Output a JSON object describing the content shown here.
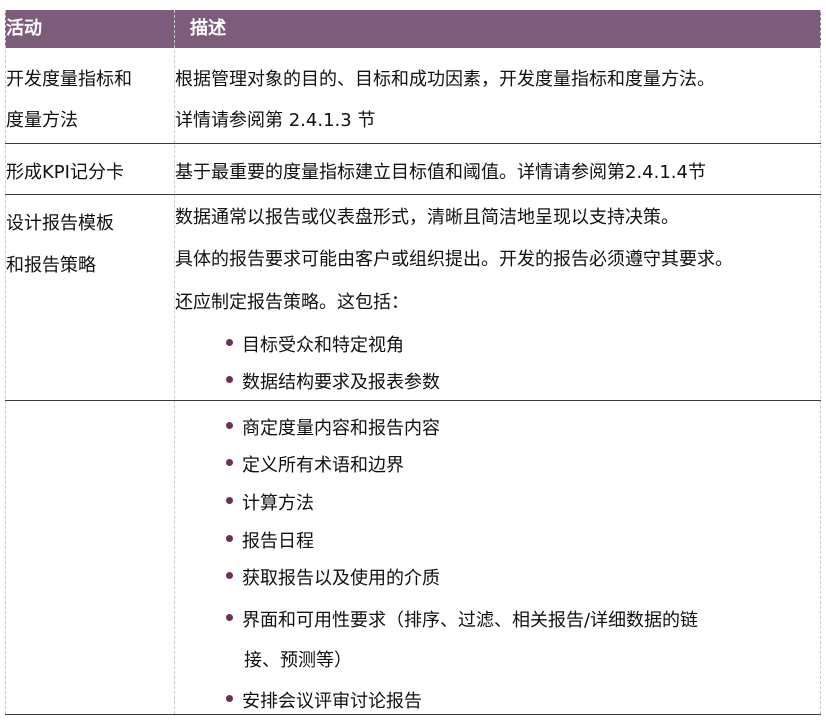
{
  "table": {
    "header": {
      "activity": "活动",
      "description": "描述"
    },
    "rows": [
      {
        "activity_lines": [
          "开发度量指标和",
          "度量方法"
        ],
        "desc_lines": [
          "根据管理对象的目的、目标和成功因素，开发度量指标和度量方法。",
          "详情请参阅第 2.4.1.3 节"
        ]
      },
      {
        "activity_lines": [
          "形成KPI记分卡"
        ],
        "desc_lines": [
          "基于最重要的度量指标建立目标值和阈值。详情请参阅第2.4.1.4节"
        ]
      },
      {
        "activity_lines": [
          "设计报告模板",
          "和报告策略"
        ],
        "desc_lines": [
          "数据通常以报告或仪表盘形式，清晰且简洁地呈现以支持决策。",
          "具体的报告要求可能由客户或组织提出。开发的报告必须遵守其要求。",
          "还应制定报告策略。这包括："
        ],
        "bullets": [
          "目标受众和特定视角",
          "数据结构要求及报表参数"
        ]
      },
      {
        "activity_lines": [],
        "bullets": [
          "商定度量内容和报告内容",
          "定义所有术语和边界",
          "计算方法",
          "报告日程",
          "获取报告以及使用的介质",
          "界面和可用性要求（排序、过滤、相关报告/详细数据的链",
          "安排会议评审讨论报告"
        ],
        "bullet_continuation": "接、预测等）"
      }
    ]
  },
  "colors": {
    "header_bg": "#7d5c7b",
    "header_text": "#ffffff",
    "bullet": "#6b2f5c"
  }
}
